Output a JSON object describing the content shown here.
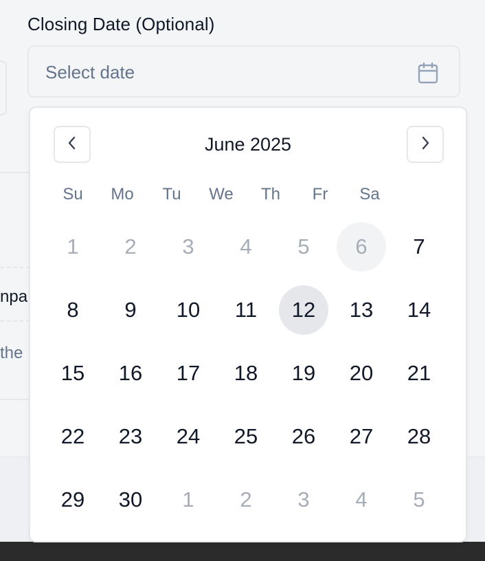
{
  "field": {
    "label": "Closing Date (Optional)",
    "placeholder": "Select date",
    "icon": "calendar-icon"
  },
  "background": {
    "snippet_1": "npa",
    "snippet_2": "the"
  },
  "calendar": {
    "month_title": "June 2025",
    "prev_icon": "chevron-left-icon",
    "next_icon": "chevron-right-icon",
    "weekdays": [
      "Su",
      "Mo",
      "Tu",
      "We",
      "Th",
      "Fr",
      "Sa"
    ],
    "weeks": [
      [
        {
          "label": "1",
          "state": "disabled"
        },
        {
          "label": "2",
          "state": "disabled"
        },
        {
          "label": "3",
          "state": "disabled"
        },
        {
          "label": "4",
          "state": "disabled"
        },
        {
          "label": "5",
          "state": "disabled"
        },
        {
          "label": "6",
          "state": "disabled-highlight"
        },
        {
          "label": "7",
          "state": "normal"
        }
      ],
      [
        {
          "label": "8",
          "state": "normal"
        },
        {
          "label": "9",
          "state": "normal"
        },
        {
          "label": "10",
          "state": "normal"
        },
        {
          "label": "11",
          "state": "normal"
        },
        {
          "label": "12",
          "state": "selected"
        },
        {
          "label": "13",
          "state": "normal"
        },
        {
          "label": "14",
          "state": "normal"
        }
      ],
      [
        {
          "label": "15",
          "state": "normal"
        },
        {
          "label": "16",
          "state": "normal"
        },
        {
          "label": "17",
          "state": "normal"
        },
        {
          "label": "18",
          "state": "normal"
        },
        {
          "label": "19",
          "state": "normal"
        },
        {
          "label": "20",
          "state": "normal"
        },
        {
          "label": "21",
          "state": "normal"
        }
      ],
      [
        {
          "label": "22",
          "state": "normal"
        },
        {
          "label": "23",
          "state": "normal"
        },
        {
          "label": "24",
          "state": "normal"
        },
        {
          "label": "25",
          "state": "normal"
        },
        {
          "label": "26",
          "state": "normal"
        },
        {
          "label": "27",
          "state": "normal"
        },
        {
          "label": "28",
          "state": "normal"
        }
      ],
      [
        {
          "label": "29",
          "state": "normal"
        },
        {
          "label": "30",
          "state": "normal"
        },
        {
          "label": "1",
          "state": "outside"
        },
        {
          "label": "2",
          "state": "outside"
        },
        {
          "label": "3",
          "state": "outside"
        },
        {
          "label": "4",
          "state": "outside"
        },
        {
          "label": "5",
          "state": "outside"
        }
      ]
    ]
  },
  "colors": {
    "text": "#111827",
    "muted": "#64748b",
    "faded_day": "#a7adb7",
    "border": "#e5e7eb",
    "selected_bg": "#e5e7eb"
  }
}
